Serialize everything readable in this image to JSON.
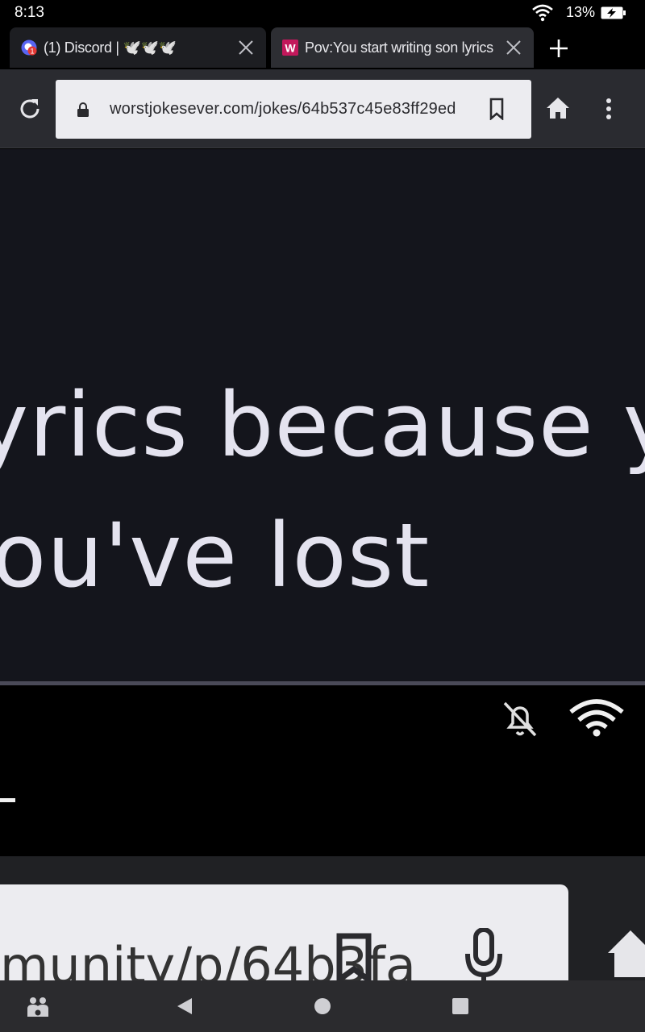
{
  "status_bar": {
    "time": "8:13",
    "battery_percent": "13%"
  },
  "tabs": [
    {
      "title": "(1) Discord | 🕊️🕊️🕊️",
      "favicon": "discord-icon",
      "active": true
    },
    {
      "title": "Pov:You start writing son lyrics",
      "favicon": "w-icon",
      "active": false
    }
  ],
  "toolbar": {
    "url": "worstjokesever.com/jokes/64b537c45e83ff29ed"
  },
  "page": {
    "line1": "yrics because you",
    "line2": "ou've lost"
  },
  "zoomed_screenshot": {
    "url_fragment": "munity/p/64b3fa"
  },
  "colors": {
    "page_background": "#14151c",
    "page_text": "#e4e3ef",
    "toolbar": "#2a2b30",
    "urlbar": "#ececf0",
    "tab_w_favicon": "#c2185b"
  }
}
